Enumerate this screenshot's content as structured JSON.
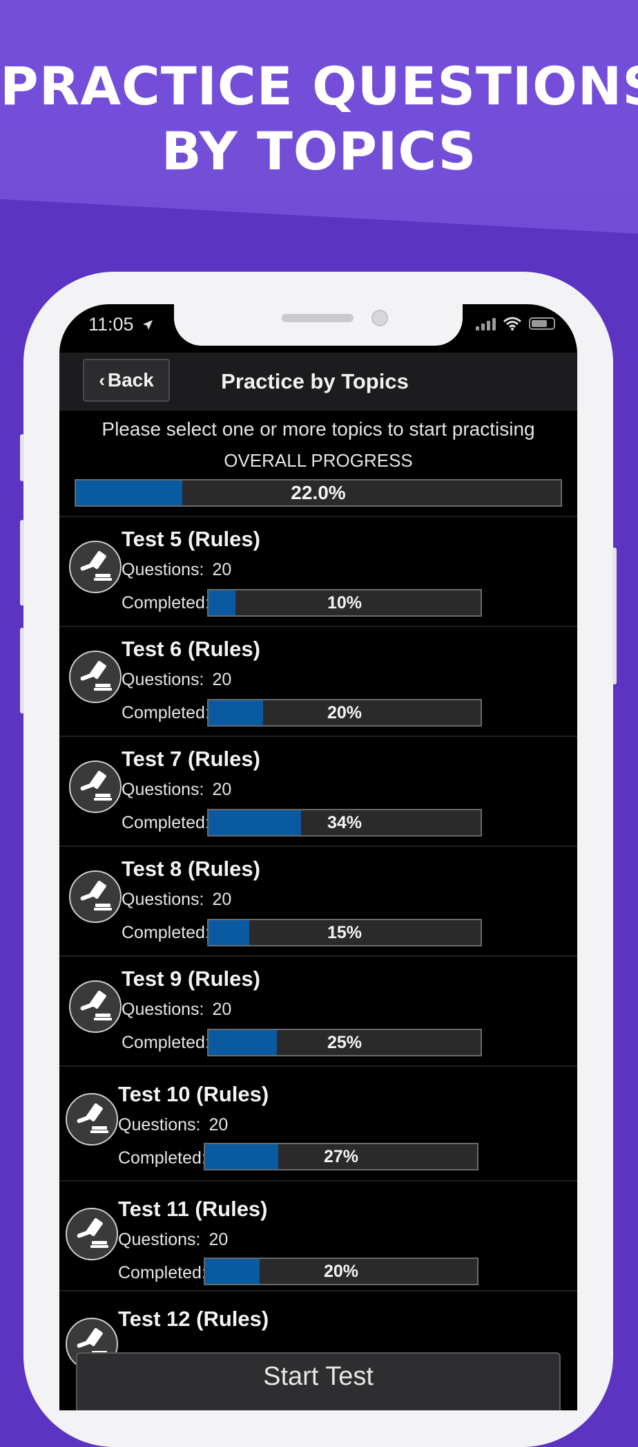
{
  "headline": {
    "line1": "PRACTICE QUESTIONS",
    "line2": "BY TOPICS"
  },
  "status_bar": {
    "time": "11:05"
  },
  "navbar": {
    "back_label": "Back",
    "title": "Practice by Topics"
  },
  "instructions": "Please select one or more topics to start practising",
  "overall_progress": {
    "label": "OVERALL PROGRESS",
    "value_text": "22.0%",
    "fraction": 0.22
  },
  "labels": {
    "questions": "Questions:",
    "completed": "Completed:"
  },
  "topics": [
    {
      "title": "Test 5 (Rules)",
      "questions": "20",
      "completed_text": "10%",
      "fraction": 0.1
    },
    {
      "title": "Test 6 (Rules)",
      "questions": "20",
      "completed_text": "20%",
      "fraction": 0.2
    },
    {
      "title": "Test 7 (Rules)",
      "questions": "20",
      "completed_text": "34%",
      "fraction": 0.34
    },
    {
      "title": "Test 8 (Rules)",
      "questions": "20",
      "completed_text": "15%",
      "fraction": 0.15
    },
    {
      "title": "Test 9 (Rules)",
      "questions": "20",
      "completed_text": "25%",
      "fraction": 0.25
    },
    {
      "title": "Test 10 (Rules)",
      "questions": "20",
      "completed_text": "27%",
      "fraction": 0.27
    },
    {
      "title": "Test 11 (Rules)",
      "questions": "20",
      "completed_text": "20%",
      "fraction": 0.2
    },
    {
      "title": "Test 12 (Rules)",
      "questions": "",
      "completed_text": "",
      "fraction": null
    }
  ],
  "start_button": "Start Test",
  "colors": {
    "progress_fill": "#0a5aa2",
    "background": "#5b34c2",
    "accent_band": "#744fd8"
  },
  "icons": {
    "row_icon": "gavel-icon",
    "back_icon": "chevron-left-icon"
  }
}
